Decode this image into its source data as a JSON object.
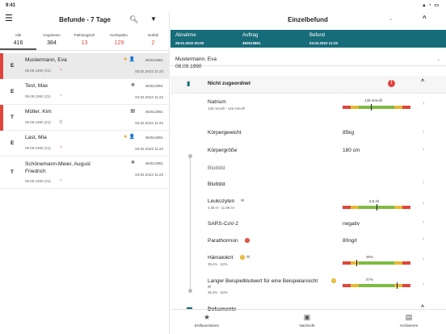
{
  "status_bar": {
    "time": "9:41",
    "icons": "▴ ◔ ▭"
  },
  "left_header": {
    "title": "Befunde - 7 Tage"
  },
  "stats": [
    {
      "label": "Alle",
      "value": "416",
      "red": false
    },
    {
      "label": "Ungelesen",
      "value": "384",
      "red": false
    },
    {
      "label": "Pathologisch",
      "value": "13",
      "red": true
    },
    {
      "label": "Hochpatho.",
      "value": "129",
      "red": true
    },
    {
      "label": "Notfall",
      "value": "2",
      "red": true
    }
  ],
  "patients": [
    {
      "type": "E",
      "name": "Mustermann, Eva",
      "dob": "08.09.1990 (21)",
      "gender": "♀",
      "id": "462513851",
      "date": "03.02.2022 11:23",
      "marks": "★ 👤",
      "flag": true
    },
    {
      "type": "E",
      "name": "Test, Max",
      "dob": "08.09.1990 (21)",
      "gender": "♂",
      "id": "462513851",
      "date": "03.02.2022 11:23",
      "marks": "✲",
      "flag": false
    },
    {
      "type": "T",
      "name": "Müller, Kim",
      "dob": "08.09.1990 (21)",
      "gender": "⚲",
      "id": "462513851",
      "date": "03.02.2022 11:23",
      "marks": "▤",
      "flag": true
    },
    {
      "type": "E",
      "name": "Last, Mia",
      "dob": "08.09.1990 (21)",
      "gender": "♀",
      "id": "462513851",
      "date": "03.02.2022 11:23",
      "marks": "★ 👤",
      "flag": false
    },
    {
      "type": "T",
      "name_line1": "Schönemann-Meier, August",
      "name_line2": "Friedrich",
      "dob": "08.09.1990 (21)",
      "gender": "♂",
      "id": "462513851",
      "date": "03.02.2022 11:23",
      "marks": "✲",
      "flag": false
    }
  ],
  "right_header": {
    "title": "Einzelbefund"
  },
  "teal": [
    {
      "label": "Abnahme",
      "value": "28.01.2022 00:00"
    },
    {
      "label": "Auftrag",
      "value": "462513851"
    },
    {
      "label": "Befund",
      "value": "03.02.2022 11:23"
    }
  ],
  "patient_info": {
    "name": "Mustermann, Eva",
    "dob": "08.09.1990"
  },
  "section": {
    "title": "Nicht zugeordnet",
    "warn": "!"
  },
  "rows": {
    "natrium": {
      "name": "Natrium",
      "sub": "136 mmol/l - 145 mmol/l",
      "bar_label": "139 mmol/l",
      "level": 0.42
    },
    "gewicht": {
      "name": "Körpergewicht",
      "value": "85kg"
    },
    "groesse": {
      "name": "Körpergröße",
      "value": "180 cm"
    },
    "blutbild_group": {
      "name": "Blutbild"
    },
    "blutbild": {
      "name": "Blutbild"
    },
    "leukozyten": {
      "name": "Leukozyten",
      "sub": "4.36  nl - 11.89 /nl",
      "bar_label": "8.8 /nl",
      "level": 0.5
    },
    "sars": {
      "name": "SARS-CoV-2",
      "value": "negativ"
    },
    "parathormon": {
      "name": "Parathormon",
      "value": "80ng/l"
    },
    "haematokrit": {
      "name": "Hämatokrit",
      "sub": "39,4% - 53%",
      "bar_label": "36%",
      "level": 0.2
    },
    "langer": {
      "name": "Langer Beispielblutwert für eine Beispielansicht",
      "sub": "39,4% - 53%",
      "bar_label": "57%",
      "level": 0.8
    }
  },
  "documents": {
    "title": "Dokumente"
  },
  "tabbar": [
    {
      "label": "Entfavorisieren",
      "icon": "★"
    },
    {
      "label": "Nachricht",
      "icon": "💬"
    },
    {
      "label": "Archivieren",
      "icon": "▤"
    }
  ],
  "colors": {
    "teal": "#176c79",
    "red": "#e0443b",
    "green": "#7dbb42",
    "yellow": "#e8b830"
  }
}
